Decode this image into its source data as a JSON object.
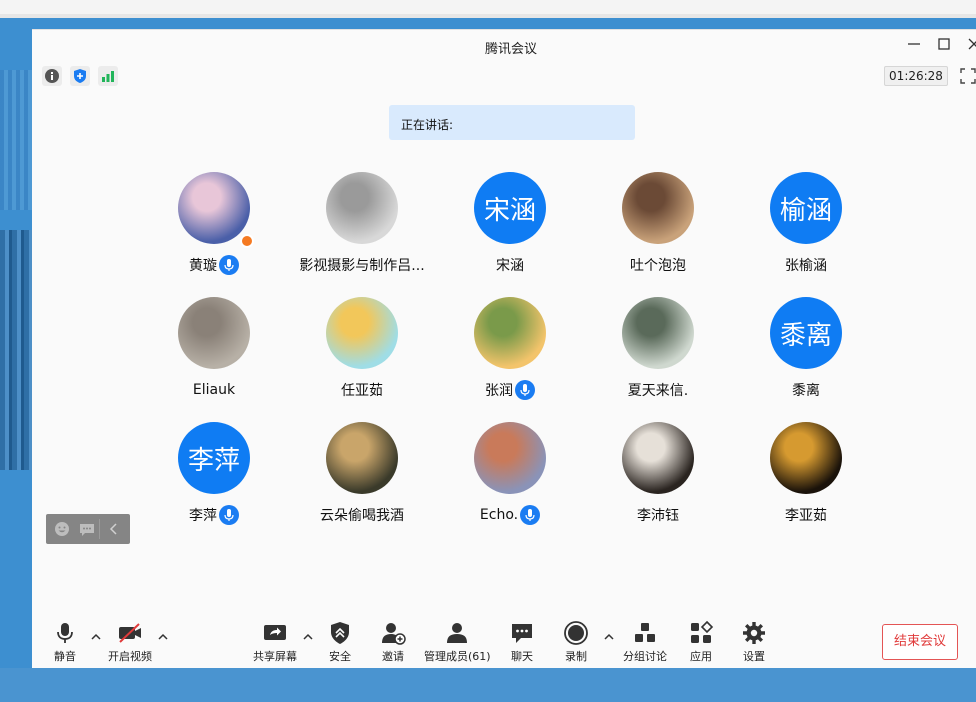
{
  "window": {
    "title": "腾讯会议"
  },
  "status": {
    "timer": "01:26:28"
  },
  "speaking": {
    "label": "正在讲话:"
  },
  "participants": [
    {
      "name": "黄璇",
      "avatar": "photo",
      "mic": true,
      "host": true
    },
    {
      "name": "影视摄影与制作吕...",
      "avatar": "photo",
      "mic": false
    },
    {
      "name": "宋涵",
      "avatar": "text",
      "avatar_text": "宋涵",
      "mic": false
    },
    {
      "name": "吐个泡泡",
      "avatar": "photo",
      "mic": false
    },
    {
      "name": "张榆涵",
      "avatar": "text",
      "avatar_text": "榆涵",
      "mic": false
    },
    {
      "name": "Eliauk",
      "avatar": "photo",
      "mic": false
    },
    {
      "name": "任亚茹",
      "avatar": "photo",
      "mic": false
    },
    {
      "name": "张润",
      "avatar": "photo",
      "mic": true
    },
    {
      "name": "夏天来信.",
      "avatar": "photo",
      "mic": false
    },
    {
      "name": "黍离",
      "avatar": "text",
      "avatar_text": "黍离",
      "mic": false
    },
    {
      "name": "李萍",
      "avatar": "text",
      "avatar_text": "李萍",
      "mic": true
    },
    {
      "name": "云朵偷喝我酒",
      "avatar": "photo",
      "mic": false
    },
    {
      "name": "Echo.",
      "avatar": "photo",
      "mic": true
    },
    {
      "name": "李沛钰",
      "avatar": "photo",
      "mic": false
    },
    {
      "name": "李亚茹",
      "avatar": "photo",
      "mic": false
    }
  ],
  "toolbar": {
    "mute": "静音",
    "video": "开启视频",
    "share": "共享屏幕",
    "security": "安全",
    "invite": "邀请",
    "members": "管理成员(61)",
    "chat": "聊天",
    "record": "录制",
    "breakout": "分组讨论",
    "apps": "应用",
    "settings": "设置",
    "end": "结束会议"
  },
  "colors": {
    "accent": "#0f7cf3",
    "end": "#e03a3a",
    "speaking_bg": "#d9eafd"
  }
}
